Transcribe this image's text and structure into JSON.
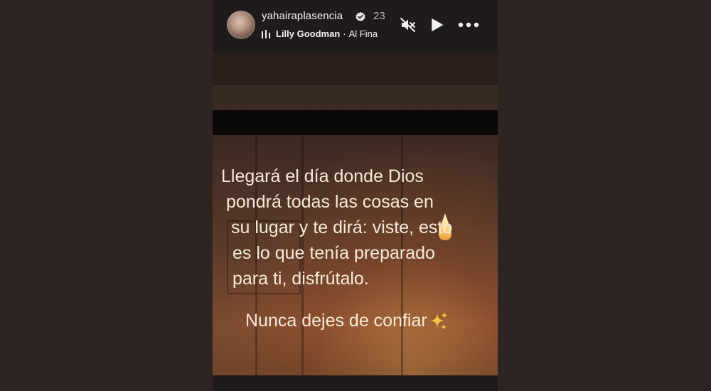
{
  "story": {
    "username": "yahairaplasencia",
    "time_ago": "23",
    "music": {
      "artist": "Lilly Goodman",
      "separator": "·",
      "song": "Al Fina"
    },
    "controls": {
      "mute_icon": "speaker-muted-icon",
      "play_icon": "play-icon",
      "more_icon": "more-options-icon"
    },
    "quote_lines": [
      "Llegará el día donde Dios",
      "pondrá todas las cosas en",
      "su lugar y te dirá: viste, esto",
      "es lo que tenía preparado",
      "para ti, disfrútalo."
    ],
    "closing_line": "Nunca dejes de confiar",
    "closing_emoji_icon": "sparkles-icon"
  },
  "colors": {
    "page_background": "#2e2522",
    "header_background": "#1f1b1a",
    "text_light": "#f6ead8",
    "sparkle_gold": "#f4c542"
  }
}
